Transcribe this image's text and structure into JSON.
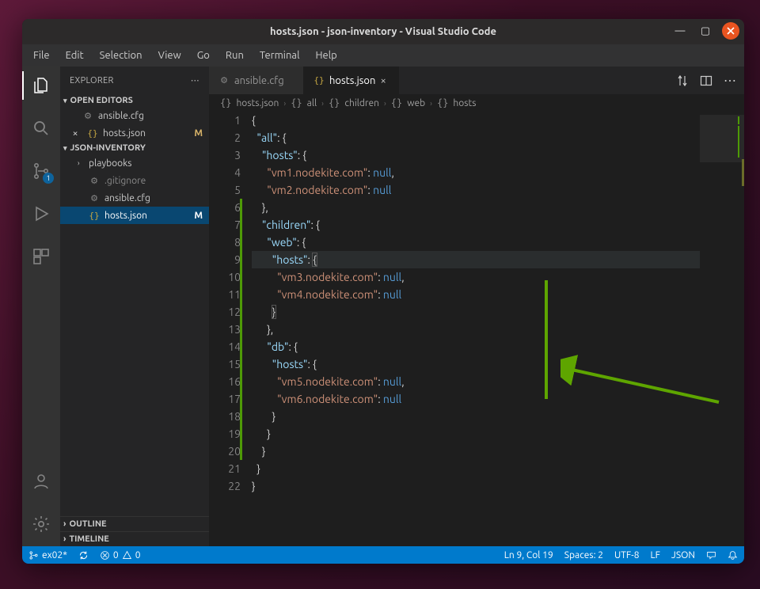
{
  "title": "hosts.json - json-inventory - Visual Studio Code",
  "menubar": {
    "items": [
      "File",
      "Edit",
      "Selection",
      "View",
      "Go",
      "Run",
      "Terminal",
      "Help"
    ]
  },
  "activitybar": {
    "scm_badge": "1"
  },
  "sidebar": {
    "header": "EXPLORER",
    "open_editors_label": "OPEN EDITORS",
    "open_editors": [
      {
        "icon": "gear",
        "name": "ansible.cfg",
        "modified": false,
        "open_close": false
      },
      {
        "icon": "braces",
        "name": "hosts.json",
        "modified": true,
        "open_close": true
      }
    ],
    "workspace_label": "JSON-INVENTORY",
    "workspace_items": [
      {
        "type": "folder",
        "name": "playbooks"
      },
      {
        "type": "file",
        "icon": "gear",
        "name": ".gitignore"
      },
      {
        "type": "file",
        "icon": "gear",
        "name": "ansible.cfg"
      },
      {
        "type": "file",
        "icon": "braces",
        "name": "hosts.json",
        "modified": true,
        "active": true
      }
    ],
    "outline_label": "OUTLINE",
    "timeline_label": "TIMELINE"
  },
  "tabs": [
    {
      "icon": "gear",
      "label": "ansible.cfg",
      "active": false,
      "dirty": false
    },
    {
      "icon": "braces",
      "label": "hosts.json",
      "active": true,
      "dirty": false
    }
  ],
  "breadcrumb": [
    "hosts.json",
    "all",
    "children",
    "web",
    "hosts"
  ],
  "code": {
    "lines": [
      {
        "n": 1,
        "git": false,
        "t": [
          [
            "{",
            "p"
          ]
        ]
      },
      {
        "n": 2,
        "git": false,
        "t": [
          [
            "  ",
            ""
          ],
          [
            "\"all\"",
            "k"
          ],
          [
            ": {",
            "p"
          ]
        ]
      },
      {
        "n": 3,
        "git": false,
        "t": [
          [
            "    ",
            ""
          ],
          [
            "\"hosts\"",
            "k"
          ],
          [
            ": {",
            "p"
          ]
        ]
      },
      {
        "n": 4,
        "git": false,
        "t": [
          [
            "      ",
            ""
          ],
          [
            "\"vm1.nodekite.com\"",
            "s"
          ],
          [
            ": ",
            "p"
          ],
          [
            "null",
            "n"
          ],
          [
            ",",
            "p"
          ]
        ]
      },
      {
        "n": 5,
        "git": false,
        "t": [
          [
            "      ",
            ""
          ],
          [
            "\"vm2.nodekite.com\"",
            "s"
          ],
          [
            ": ",
            "p"
          ],
          [
            "null",
            "n"
          ]
        ]
      },
      {
        "n": 6,
        "git": true,
        "t": [
          [
            "    },",
            "p"
          ]
        ]
      },
      {
        "n": 7,
        "git": true,
        "t": [
          [
            "    ",
            ""
          ],
          [
            "\"children\"",
            "k"
          ],
          [
            ": {",
            "p"
          ]
        ]
      },
      {
        "n": 8,
        "git": true,
        "t": [
          [
            "      ",
            ""
          ],
          [
            "\"web\"",
            "k"
          ],
          [
            ": {",
            "p"
          ]
        ]
      },
      {
        "n": 9,
        "git": true,
        "hl": true,
        "t": [
          [
            "        ",
            ""
          ],
          [
            "\"hosts\"",
            "k"
          ],
          [
            ": ",
            "p"
          ],
          [
            "{",
            "bh"
          ]
        ]
      },
      {
        "n": 10,
        "git": true,
        "t": [
          [
            "          ",
            ""
          ],
          [
            "\"vm3.nodekite.com\"",
            "s"
          ],
          [
            ": ",
            "p"
          ],
          [
            "null",
            "n"
          ],
          [
            ",",
            "p"
          ]
        ]
      },
      {
        "n": 11,
        "git": true,
        "t": [
          [
            "          ",
            ""
          ],
          [
            "\"vm4.nodekite.com\"",
            "s"
          ],
          [
            ": ",
            "p"
          ],
          [
            "null",
            "n"
          ]
        ]
      },
      {
        "n": 12,
        "git": true,
        "t": [
          [
            "        ",
            ""
          ],
          [
            "}",
            "bh"
          ]
        ]
      },
      {
        "n": 13,
        "git": true,
        "t": [
          [
            "      },",
            "p"
          ]
        ]
      },
      {
        "n": 14,
        "git": true,
        "t": [
          [
            "      ",
            ""
          ],
          [
            "\"db\"",
            "k"
          ],
          [
            ": {",
            "p"
          ]
        ]
      },
      {
        "n": 15,
        "git": true,
        "t": [
          [
            "        ",
            ""
          ],
          [
            "\"hosts\"",
            "k"
          ],
          [
            ": {",
            "p"
          ]
        ]
      },
      {
        "n": 16,
        "git": true,
        "t": [
          [
            "          ",
            ""
          ],
          [
            "\"vm5.nodekite.com\"",
            "s"
          ],
          [
            ": ",
            "p"
          ],
          [
            "null",
            "n"
          ],
          [
            ",",
            "p"
          ]
        ]
      },
      {
        "n": 17,
        "git": true,
        "t": [
          [
            "          ",
            ""
          ],
          [
            "\"vm6.nodekite.com\"",
            "s"
          ],
          [
            ": ",
            "p"
          ],
          [
            "null",
            "n"
          ]
        ]
      },
      {
        "n": 18,
        "git": true,
        "t": [
          [
            "        }",
            "p"
          ]
        ]
      },
      {
        "n": 19,
        "git": true,
        "t": [
          [
            "      }",
            "p"
          ]
        ]
      },
      {
        "n": 20,
        "git": true,
        "t": [
          [
            "    }",
            "p"
          ]
        ]
      },
      {
        "n": 21,
        "git": false,
        "t": [
          [
            "  }",
            "p"
          ]
        ]
      },
      {
        "n": 22,
        "git": false,
        "t": [
          [
            "}",
            "p"
          ]
        ]
      }
    ]
  },
  "statusbar": {
    "branch": "ex02*",
    "sync": "",
    "errors": "0",
    "warnings": "0",
    "cursor": "Ln 9, Col 19",
    "spaces": "Spaces: 2",
    "encoding": "UTF-8",
    "eol": "LF",
    "language": "JSON"
  }
}
